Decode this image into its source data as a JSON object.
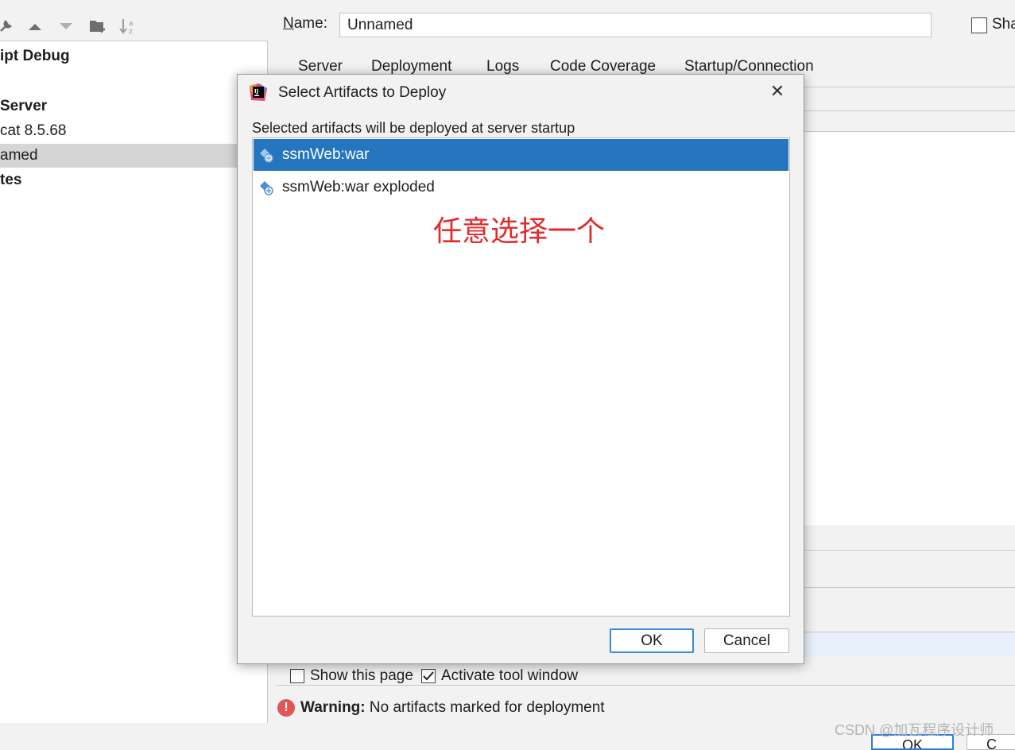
{
  "background": {
    "toolbar_icons": [
      "wrench-icon",
      "arrow-up-icon",
      "arrow-down-icon",
      "new-folder-icon",
      "sort-icon"
    ],
    "tree": [
      {
        "label": "ipt Debug",
        "bold": true
      },
      {
        "label": " Server",
        "bold": true
      },
      {
        "label": "cat 8.5.68",
        "bold": false
      },
      {
        "label": "amed",
        "bold": false,
        "selected": true
      },
      {
        "label": "tes",
        "bold": true
      }
    ],
    "name_label_prefix": "N",
    "name_label_rest": "ame:",
    "name_value": "Unnamed",
    "share_label": "Sha",
    "tabs": [
      "Server",
      "Deployment",
      "Logs",
      "Code Coverage",
      "Startup/Connection"
    ],
    "show_page_label": "Show this page",
    "activate_label": "Activate tool window",
    "warning_bold": "Warning:",
    "warning_text": " No artifacts marked for deployment",
    "ok_label": "OK",
    "cancel_label": "C"
  },
  "dialog": {
    "title": "Select Artifacts to Deploy",
    "close_glyph": "✕",
    "hint": "Selected artifacts will be deployed at server startup",
    "artifacts": [
      {
        "label": "ssmWeb:war",
        "selected": true
      },
      {
        "label": "ssmWeb:war exploded",
        "selected": false
      }
    ],
    "annotation": "任意选择一个",
    "ok_label": "OK",
    "cancel_label": "Cancel"
  },
  "watermark": "CSDN @加瓦程序设计师",
  "colors": {
    "selection": "#2675bf",
    "annotation": "#e22b2b",
    "warning": "#e05555",
    "focus_border": "#3a8bd6"
  }
}
